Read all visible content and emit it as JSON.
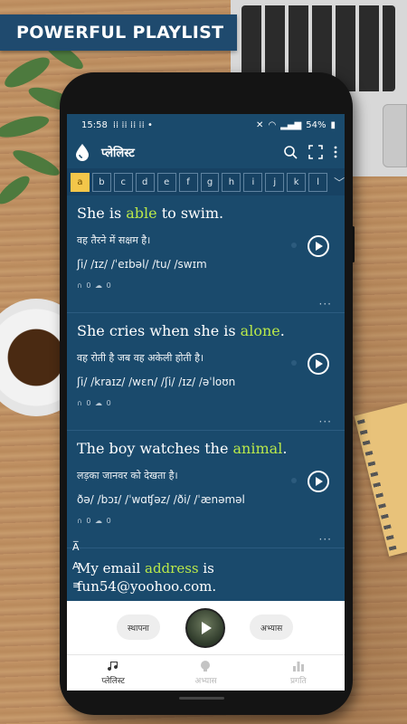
{
  "banner": {
    "text": "POWERFUL PLAYLIST"
  },
  "status_bar": {
    "time": "15:58",
    "battery": "54%"
  },
  "app_bar": {
    "title": "प्लेलिस्ट"
  },
  "alphabet": {
    "letters": [
      "a",
      "b",
      "c",
      "d",
      "e",
      "f",
      "g",
      "h",
      "i",
      "j",
      "k",
      "l"
    ],
    "selected": "a"
  },
  "cards": [
    {
      "before": "She is ",
      "highlight": "able",
      "after": " to swim.",
      "hindi": "वह तैरने में सक्षम है।",
      "ipa": "ʃi/ /ɪz/ /ˈeɪbəl/ /tu/ /swɪm",
      "meta": "∩ 0  ☁ 0"
    },
    {
      "before": "She cries when she is ",
      "highlight": "alone",
      "after": ".",
      "hindi": "वह रोती है जब वह अकेली होती है।",
      "ipa": "ʃi/ /kraɪz/ /wɛn/ /ʃi/ /ɪz/ /əˈloʊn",
      "meta": "∩ 0  ☁ 0"
    },
    {
      "before": "The boy watches the ",
      "highlight": "animal",
      "after": ".",
      "hindi": "लड़का जानवर को देखता है।",
      "ipa": "ðə/ /bɔɪ/ /ˈwɑʧəz/ /ði/ /ˈænəməl",
      "meta": "∩ 0  ☁ 0"
    },
    {
      "before": "My email ",
      "highlight": "address",
      "after": " is fun54@yoohoo.com."
    }
  ],
  "bottom": {
    "left_pill": "स्थापना",
    "right_pill": "अभ्यास"
  },
  "tabs": [
    {
      "label": "प्लेलिस्ट",
      "icon": "music-note-icon",
      "active": true
    },
    {
      "label": "अभ्यास",
      "icon": "brain-icon",
      "active": false
    },
    {
      "label": "प्रगति",
      "icon": "bar-chart-icon",
      "active": false
    }
  ],
  "colors": {
    "screen_bg": "#1a4a6c",
    "highlight": "#b9e84a",
    "active_letter": "#f3c64a",
    "banner_bg": "#1f4a6e"
  }
}
